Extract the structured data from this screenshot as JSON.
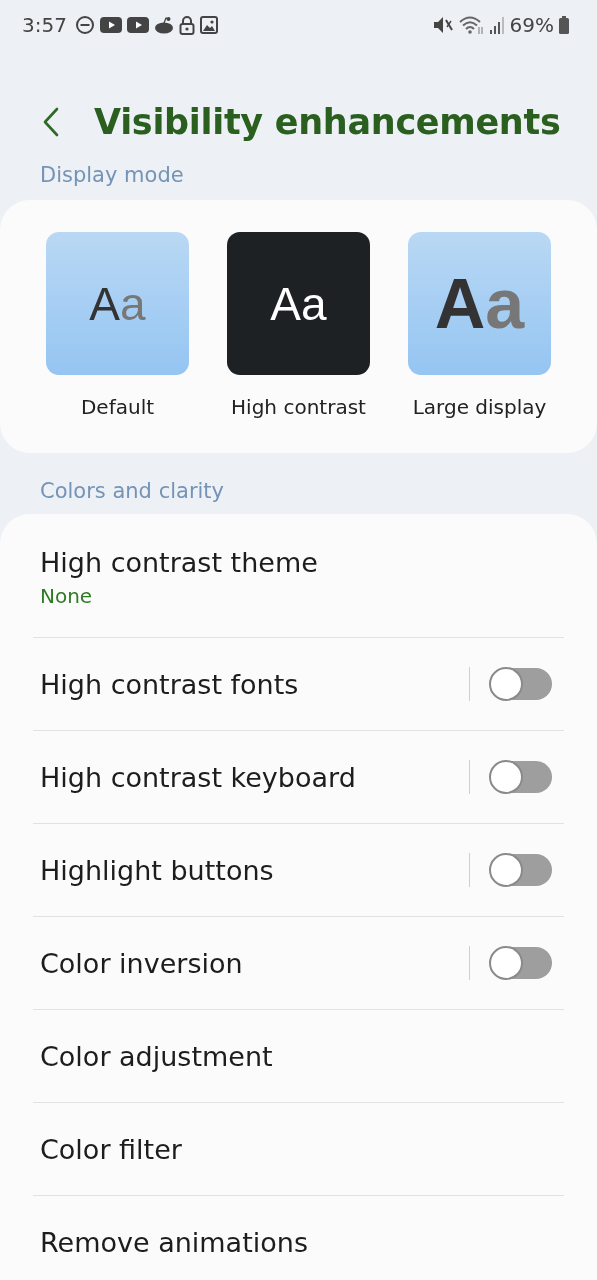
{
  "status_bar": {
    "time": "3:57",
    "battery": "69%"
  },
  "header": {
    "title": "Visibility enhancements"
  },
  "display_mode": {
    "heading": "Display mode",
    "options": [
      {
        "label": "Default",
        "preview": "Aa",
        "kind": "default"
      },
      {
        "label": "High contrast",
        "preview": "Aa",
        "kind": "contrast"
      },
      {
        "label": "Large display",
        "preview": "Aa",
        "kind": "large"
      }
    ]
  },
  "colors_and_clarity": {
    "heading": "Colors and clarity",
    "items": [
      {
        "kind": "value",
        "label": "High contrast theme",
        "value": "None"
      },
      {
        "kind": "switch",
        "label": "High contrast fonts",
        "on": false
      },
      {
        "kind": "switch",
        "label": "High contrast keyboard",
        "on": false
      },
      {
        "kind": "switch",
        "label": "Highlight buttons",
        "on": false
      },
      {
        "kind": "switch",
        "label": "Color inversion",
        "on": false
      },
      {
        "kind": "link",
        "label": "Color adjustment"
      },
      {
        "kind": "link",
        "label": "Color filter"
      },
      {
        "kind": "link",
        "label": "Remove animations"
      }
    ]
  }
}
